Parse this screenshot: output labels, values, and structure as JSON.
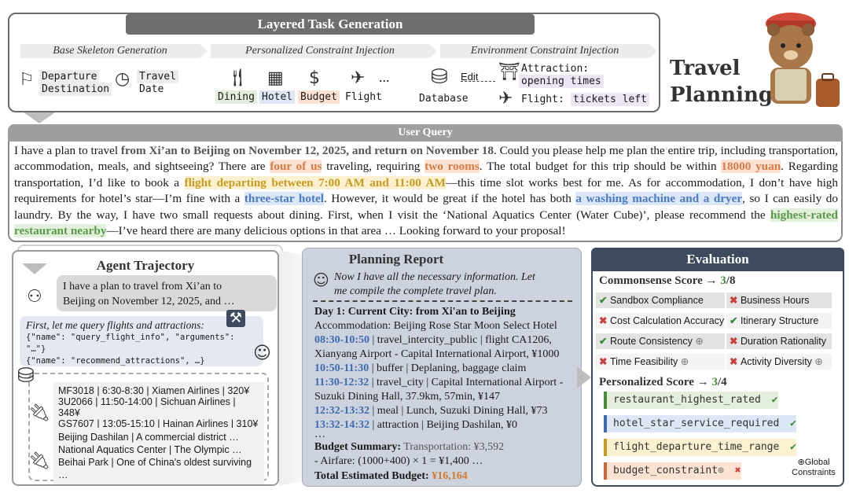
{
  "top": {
    "title": "Layered Task Generation",
    "stages": [
      "Base Skeleton Generation",
      "Personalized Constraint Injection",
      "Environment Constraint Injection"
    ],
    "base": {
      "departure": "Departure",
      "destination": "Destination",
      "travel": "Travel",
      "date": "Date"
    },
    "constraints": {
      "dining": "Dining",
      "hotel": "Hotel",
      "budget": "Budget",
      "flight": "Flight",
      "more": "..."
    },
    "env": {
      "database": "Database",
      "edit": "Edit",
      "attraction_label": "Attraction:",
      "attraction_value": "opening times",
      "flight_label": "Flight:",
      "flight_value": "tickets left"
    },
    "side_title_1": "Travel",
    "side_title_2": "Planning"
  },
  "user_query": {
    "title": "User Query",
    "p1": "I have a plan to travel ",
    "h1": "from Xi’an to Beijing on November 12, 2025, and return on November 18",
    "p2": ". Could you please help me plan the entire trip, including transportation, accommodation, meals, and sightseeing? There are ",
    "h2": "four of us",
    "p3": " traveling, requiring ",
    "h3": "two rooms",
    "p4": ". The total budget for this trip should be within ",
    "h4": "18000 yuan",
    "p5": ". Regarding transportation, I’d like to book a ",
    "h5": "flight departing between 7:00 AM and 11:00 AM",
    "p6": "—this time slot works best for me. As for accommodation, I don’t have high requirements for hotel’s star—I’m fine with a ",
    "h6": "three-star hotel",
    "p7": ". However, it would be great if the hotel has both ",
    "h7": "a washing machine and a dryer",
    "p8": ", so I can easily do laundry. By the way, I have two small requests about dining. First, when I visit the ‘National Aquatics Center (Water Cube)’, please recommend the ",
    "h8": "highest-rated restaurant nearby",
    "p9": "—I’ve heard there are many delicious options in that area … Looking forward to your proposal!"
  },
  "agent": {
    "title": "Agent Trajectory",
    "user_msg_1": "I have a plan to travel from Xi’an to",
    "user_msg_2": "Beijing on November 12, 2025, and …",
    "agent_msg": "First, let me query flights and attractions:",
    "call1": "{\"name\": \"query_flight_info\", \"arguments\": \"…\"}",
    "call2": "{\"name\": \"recommend_attractions\", …}",
    "flights": [
      "MF3018 | 6:30-8:30 | Xiamen Airlines | 320¥",
      "3U2066 | 11:50-14:00 | Sichuan Airlines | 348¥",
      "GS7607 | 13:05-15:10 | Hainan Airlines | 310¥"
    ],
    "attractions": [
      "Beijing Dashilan | A commercial district …",
      "National Aquatics Center | The Olympic …",
      "Beihai Park | One of China's oldest surviving …"
    ]
  },
  "report": {
    "title": "Planning Report",
    "intro_1": "Now I have all the necessary information. Let",
    "intro_2": "me compile the complete travel plan.",
    "day": "Day 1: Current City: from Xi'an to Beijing",
    "accom": "Accommodation: Beijing Rose Star Moon Select Hotel",
    "items": [
      {
        "t": "08:30-10:50",
        "d": " | travel_intercity_public | flight CA1206,"
      },
      {
        "t": "",
        "d": "Xianyang Airport - Capital International Airport, ¥1000"
      },
      {
        "t": "10:50-11:30",
        "d": " | buffer | Deplaning, baggage claim"
      },
      {
        "t": "11:30-12:32",
        "d": " | travel_city | Capital International Airport -"
      },
      {
        "t": "",
        "d": "Suzuki Dining Hall, 37.9km, 57min, ¥147"
      },
      {
        "t": "12:32-13:32",
        "d": " | meal | Lunch, Suzuki Dining Hall, ¥73"
      },
      {
        "t": "13:32-14:32",
        "d": " | attraction | Beijing Dashilan, ¥0"
      }
    ],
    "ellipsis": "…",
    "budget_label": "Budget Summary:",
    "budget_transport": " Transportation: ¥3,592",
    "airfare": "- Airfare: (1000+400) × 1 = ¥1,400 …",
    "total_label": "Total Estimated Budget:",
    "total_value": "¥16,164"
  },
  "evaluation": {
    "title": "Evaluation",
    "common_label": "Commonsense Score → ",
    "common_num": "3",
    "common_den": "/8",
    "common": [
      {
        "name": "Sandbox Compliance",
        "ok": true
      },
      {
        "name": "Business Hours",
        "ok": false
      },
      {
        "name": "Cost Calculation Accuracy",
        "ok": false
      },
      {
        "name": "Itinerary Structure",
        "ok": true
      },
      {
        "name": "Route Consistency",
        "ok": true
      },
      {
        "name": "Duration Rationality",
        "ok": false
      },
      {
        "name": "Time Feasibility",
        "ok": false
      },
      {
        "name": "Activity Diversity",
        "ok": false
      }
    ],
    "pers_label": "Personalized Score → ",
    "pers_num": "3",
    "pers_den": "/4",
    "personal": [
      {
        "name": "restaurant_highest_rated",
        "ok": true,
        "color": "#4a8a3a",
        "bg": "#e3efdc"
      },
      {
        "name": "hotel_star_service_required",
        "ok": true,
        "color": "#3e6bb0",
        "bg": "#dde7f6"
      },
      {
        "name": "flight_departure_time_range",
        "ok": true,
        "color": "#c89a20",
        "bg": "#fbf0cf"
      },
      {
        "name": "budget_constraint",
        "ok": false,
        "color": "#c86a3a",
        "bg": "#fbe2d3"
      }
    ],
    "legend_1": "Global",
    "legend_2": "Constraints"
  }
}
